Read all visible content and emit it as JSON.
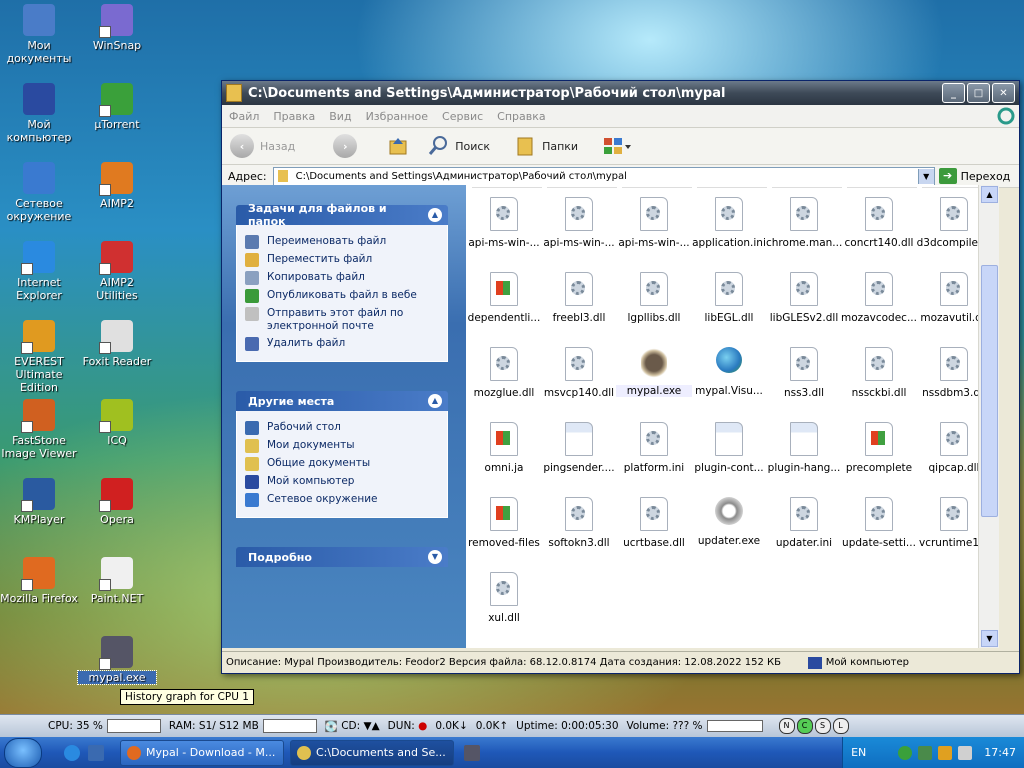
{
  "desktop": {
    "icons": [
      {
        "label": "Мои документы",
        "color": "#4a7cc8"
      },
      {
        "label": "WinSnap",
        "color": "#7a6ad0"
      },
      {
        "label": "Мой компьютер",
        "color": "#2a4aa0"
      },
      {
        "label": "µTorrent",
        "color": "#3aa03a"
      },
      {
        "label": "Сетевое окружение",
        "color": "#3a7ad0"
      },
      {
        "label": "AIMP2",
        "color": "#e07a20"
      },
      {
        "label": "Internet Explorer",
        "color": "#2a8ae0"
      },
      {
        "label": "AIMP2 Utilities",
        "color": "#d03030"
      },
      {
        "label": "EVEREST Ultimate Edition",
        "color": "#e09a20"
      },
      {
        "label": "Foxit Reader",
        "color": "#e0e0e0"
      },
      {
        "label": "FastStone Image Viewer",
        "color": "#d06020"
      },
      {
        "label": "ICQ",
        "color": "#a0c020"
      },
      {
        "label": "KMPlayer",
        "color": "#2a5aa0"
      },
      {
        "label": "Opera",
        "color": "#d02020"
      },
      {
        "label": "Mozilla Firefox",
        "color": "#e06a20"
      },
      {
        "label": "Paint.NET",
        "color": "#f0f0f0"
      },
      {
        "label": "mypal.exe",
        "color": "#556"
      }
    ]
  },
  "tooltip": "History graph for CPU 1",
  "window": {
    "title": "C:\\Documents and Settings\\Администратор\\Рабочий стол\\mypal",
    "menu": [
      "Файл",
      "Правка",
      "Вид",
      "Избранное",
      "Сервис",
      "Справка"
    ],
    "toolbar": {
      "back": "Назад",
      "search": "Поиск",
      "folders": "Папки"
    },
    "address": {
      "label": "Адрес:",
      "value": "C:\\Documents and Settings\\Администратор\\Рабочий стол\\mypal",
      "go": "Переход"
    },
    "tasks_panel": {
      "title": "Задачи для файлов и папок",
      "items": [
        {
          "label": "Переименовать файл",
          "color": "#5a7ab0"
        },
        {
          "label": "Переместить файл",
          "color": "#e0b040"
        },
        {
          "label": "Копировать файл",
          "color": "#8aa0c0"
        },
        {
          "label": "Опубликовать файл в вебе",
          "color": "#3a9a3a"
        },
        {
          "label": "Отправить этот файл по электронной почте",
          "color": "#c0c0c0"
        },
        {
          "label": "Удалить файл",
          "color": "#4a6ab0"
        }
      ]
    },
    "places_panel": {
      "title": "Другие места",
      "items": [
        {
          "label": "Рабочий стол",
          "color": "#3a6ab0"
        },
        {
          "label": "Мои документы",
          "color": "#e0c050"
        },
        {
          "label": "Общие документы",
          "color": "#e0c050"
        },
        {
          "label": "Мой компьютер",
          "color": "#2a4aa0"
        },
        {
          "label": "Сетевое окружение",
          "color": "#3a7ad0"
        }
      ]
    },
    "details_panel": {
      "title": "Подробно"
    },
    "files": [
      {
        "name": "api-ms-win-...",
        "kind": "gear"
      },
      {
        "name": "api-ms-win-...",
        "kind": "gear"
      },
      {
        "name": "api-ms-win-...",
        "kind": "gear"
      },
      {
        "name": "application.ini",
        "kind": "gear"
      },
      {
        "name": "chrome.man...",
        "kind": "gear"
      },
      {
        "name": "concrt140.dll",
        "kind": "gear"
      },
      {
        "name": "d3dcompiler...",
        "kind": "gear"
      },
      {
        "name": "dependentli...",
        "kind": "win"
      },
      {
        "name": "freebl3.dll",
        "kind": "gear"
      },
      {
        "name": "lgpllibs.dll",
        "kind": "gear"
      },
      {
        "name": "libEGL.dll",
        "kind": "gear"
      },
      {
        "name": "libGLESv2.dll",
        "kind": "gear"
      },
      {
        "name": "mozavcodec...",
        "kind": "gear"
      },
      {
        "name": "mozavutil.dll",
        "kind": "gear"
      },
      {
        "name": "mozglue.dll",
        "kind": "gear"
      },
      {
        "name": "msvcp140.dll",
        "kind": "gear"
      },
      {
        "name": "mypal.exe",
        "kind": "raccoon"
      },
      {
        "name": "mypal.Visu...",
        "kind": "globe"
      },
      {
        "name": "nss3.dll",
        "kind": "gear"
      },
      {
        "name": "nssckbi.dll",
        "kind": "gear"
      },
      {
        "name": "nssdbm3.dll",
        "kind": "gear"
      },
      {
        "name": "omni.ja",
        "kind": "win"
      },
      {
        "name": "pingsender....",
        "kind": "app"
      },
      {
        "name": "platform.ini",
        "kind": "gear"
      },
      {
        "name": "plugin-cont...",
        "kind": "app"
      },
      {
        "name": "plugin-hang...",
        "kind": "app"
      },
      {
        "name": "precomplete",
        "kind": "win"
      },
      {
        "name": "qipcap.dll",
        "kind": "gear"
      },
      {
        "name": "removed-files",
        "kind": "win"
      },
      {
        "name": "softokn3.dll",
        "kind": "gear"
      },
      {
        "name": "ucrtbase.dll",
        "kind": "gear"
      },
      {
        "name": "updater.exe",
        "kind": "updater"
      },
      {
        "name": "updater.ini",
        "kind": "gear"
      },
      {
        "name": "update-setti...",
        "kind": "gear"
      },
      {
        "name": "vcruntime1...",
        "kind": "gear"
      },
      {
        "name": "xul.dll",
        "kind": "gear"
      }
    ],
    "status": {
      "text": "Описание: Mypal Производитель: Feodor2 Версия файла: 68.12.0.8174 Дата создания: 12.08.2022 152 КБ",
      "zone": "Мой компьютер"
    }
  },
  "monitor_bar": {
    "cpu_label": "CPU:",
    "cpu_value": "35 %",
    "ram_label": "RAM:",
    "ram_value": "S1/ S12 MB",
    "cd_label": "CD:",
    "dun_label": "DUN:",
    "down_rate": "0.0K",
    "up_rate": "0.0K",
    "uptime_label": "Uptime:",
    "uptime_value": "0:00:05:30",
    "volume_label": "Volume:",
    "volume_value": "??? %",
    "modes": [
      "N",
      "C",
      "S",
      "L"
    ]
  },
  "taskbar": {
    "tasks": [
      {
        "label": "Mypal - Download - M...",
        "color": "#e06a20",
        "active": false
      },
      {
        "label": "C:\\Documents and Se...",
        "color": "#e0c050",
        "active": true
      }
    ],
    "lang": "EN",
    "clock": "17:47"
  }
}
